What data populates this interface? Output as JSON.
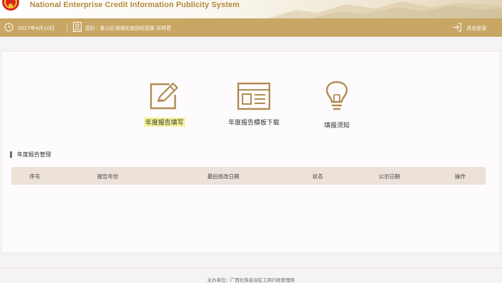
{
  "header": {
    "system_title": "National Enterprise Credit Information Publicity System"
  },
  "toolbar": {
    "date": "2017年4月10日",
    "greeting": "您好：象山区濒湖化旅园经营部  邓林君",
    "logout_label": "退出登录"
  },
  "actions": [
    {
      "label": "年度报告填写",
      "icon": "edit-form-icon",
      "highlighted": true
    },
    {
      "label": "年度报告模板下载",
      "icon": "template-download-icon"
    },
    {
      "label": "填报须知",
      "icon": "lightbulb-icon"
    }
  ],
  "section": {
    "title": "年度报告管理"
  },
  "table": {
    "columns": [
      "序号",
      "报告年份",
      "最后修改日期",
      "状态",
      "公示日期",
      "操作"
    ],
    "rows": []
  },
  "footer": {
    "sponsor": "主办单位：广西壮族自治区工商行政管理局"
  },
  "colors": {
    "gold": "#c8a663",
    "title_gold": "#b48a3c",
    "table_header": "#ece2d9",
    "highlight": "#f4f39a"
  }
}
